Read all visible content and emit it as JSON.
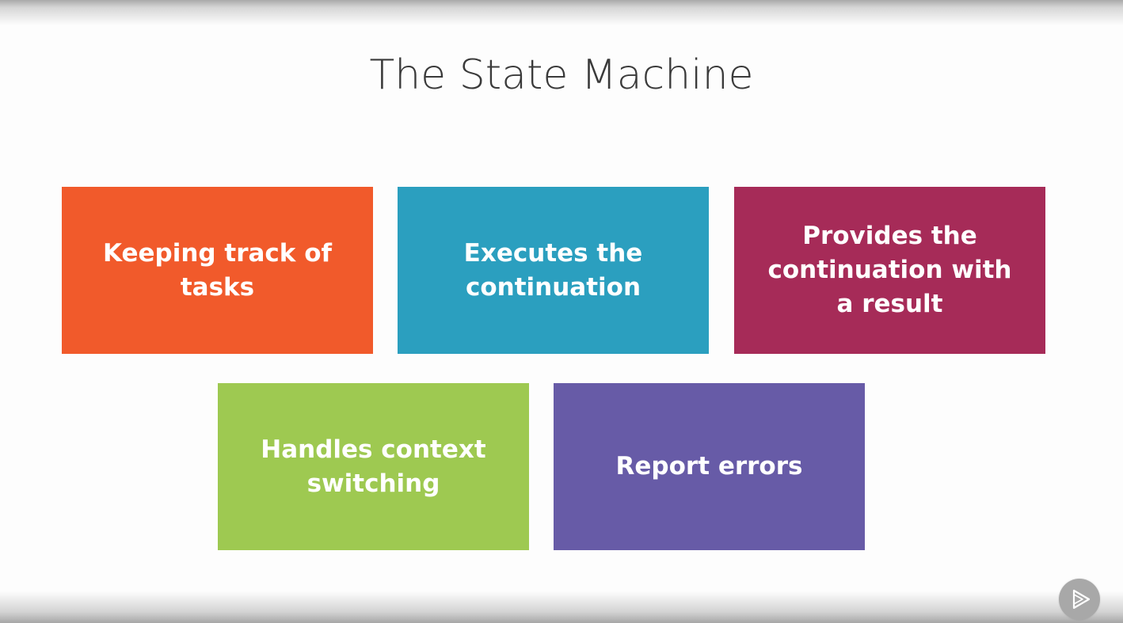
{
  "slide": {
    "title": "The State Machine",
    "boxes": [
      {
        "label": "Keeping track of tasks",
        "color": "#f15a2b"
      },
      {
        "label": "Executes the continuation",
        "color": "#2b9fbf"
      },
      {
        "label": "Provides the continuation with a result",
        "color": "#a62b58"
      },
      {
        "label": "Handles context switching",
        "color": "#9ec951"
      },
      {
        "label": "Report errors",
        "color": "#675ba7"
      }
    ]
  },
  "player": {
    "icon": "play-logo-icon"
  }
}
